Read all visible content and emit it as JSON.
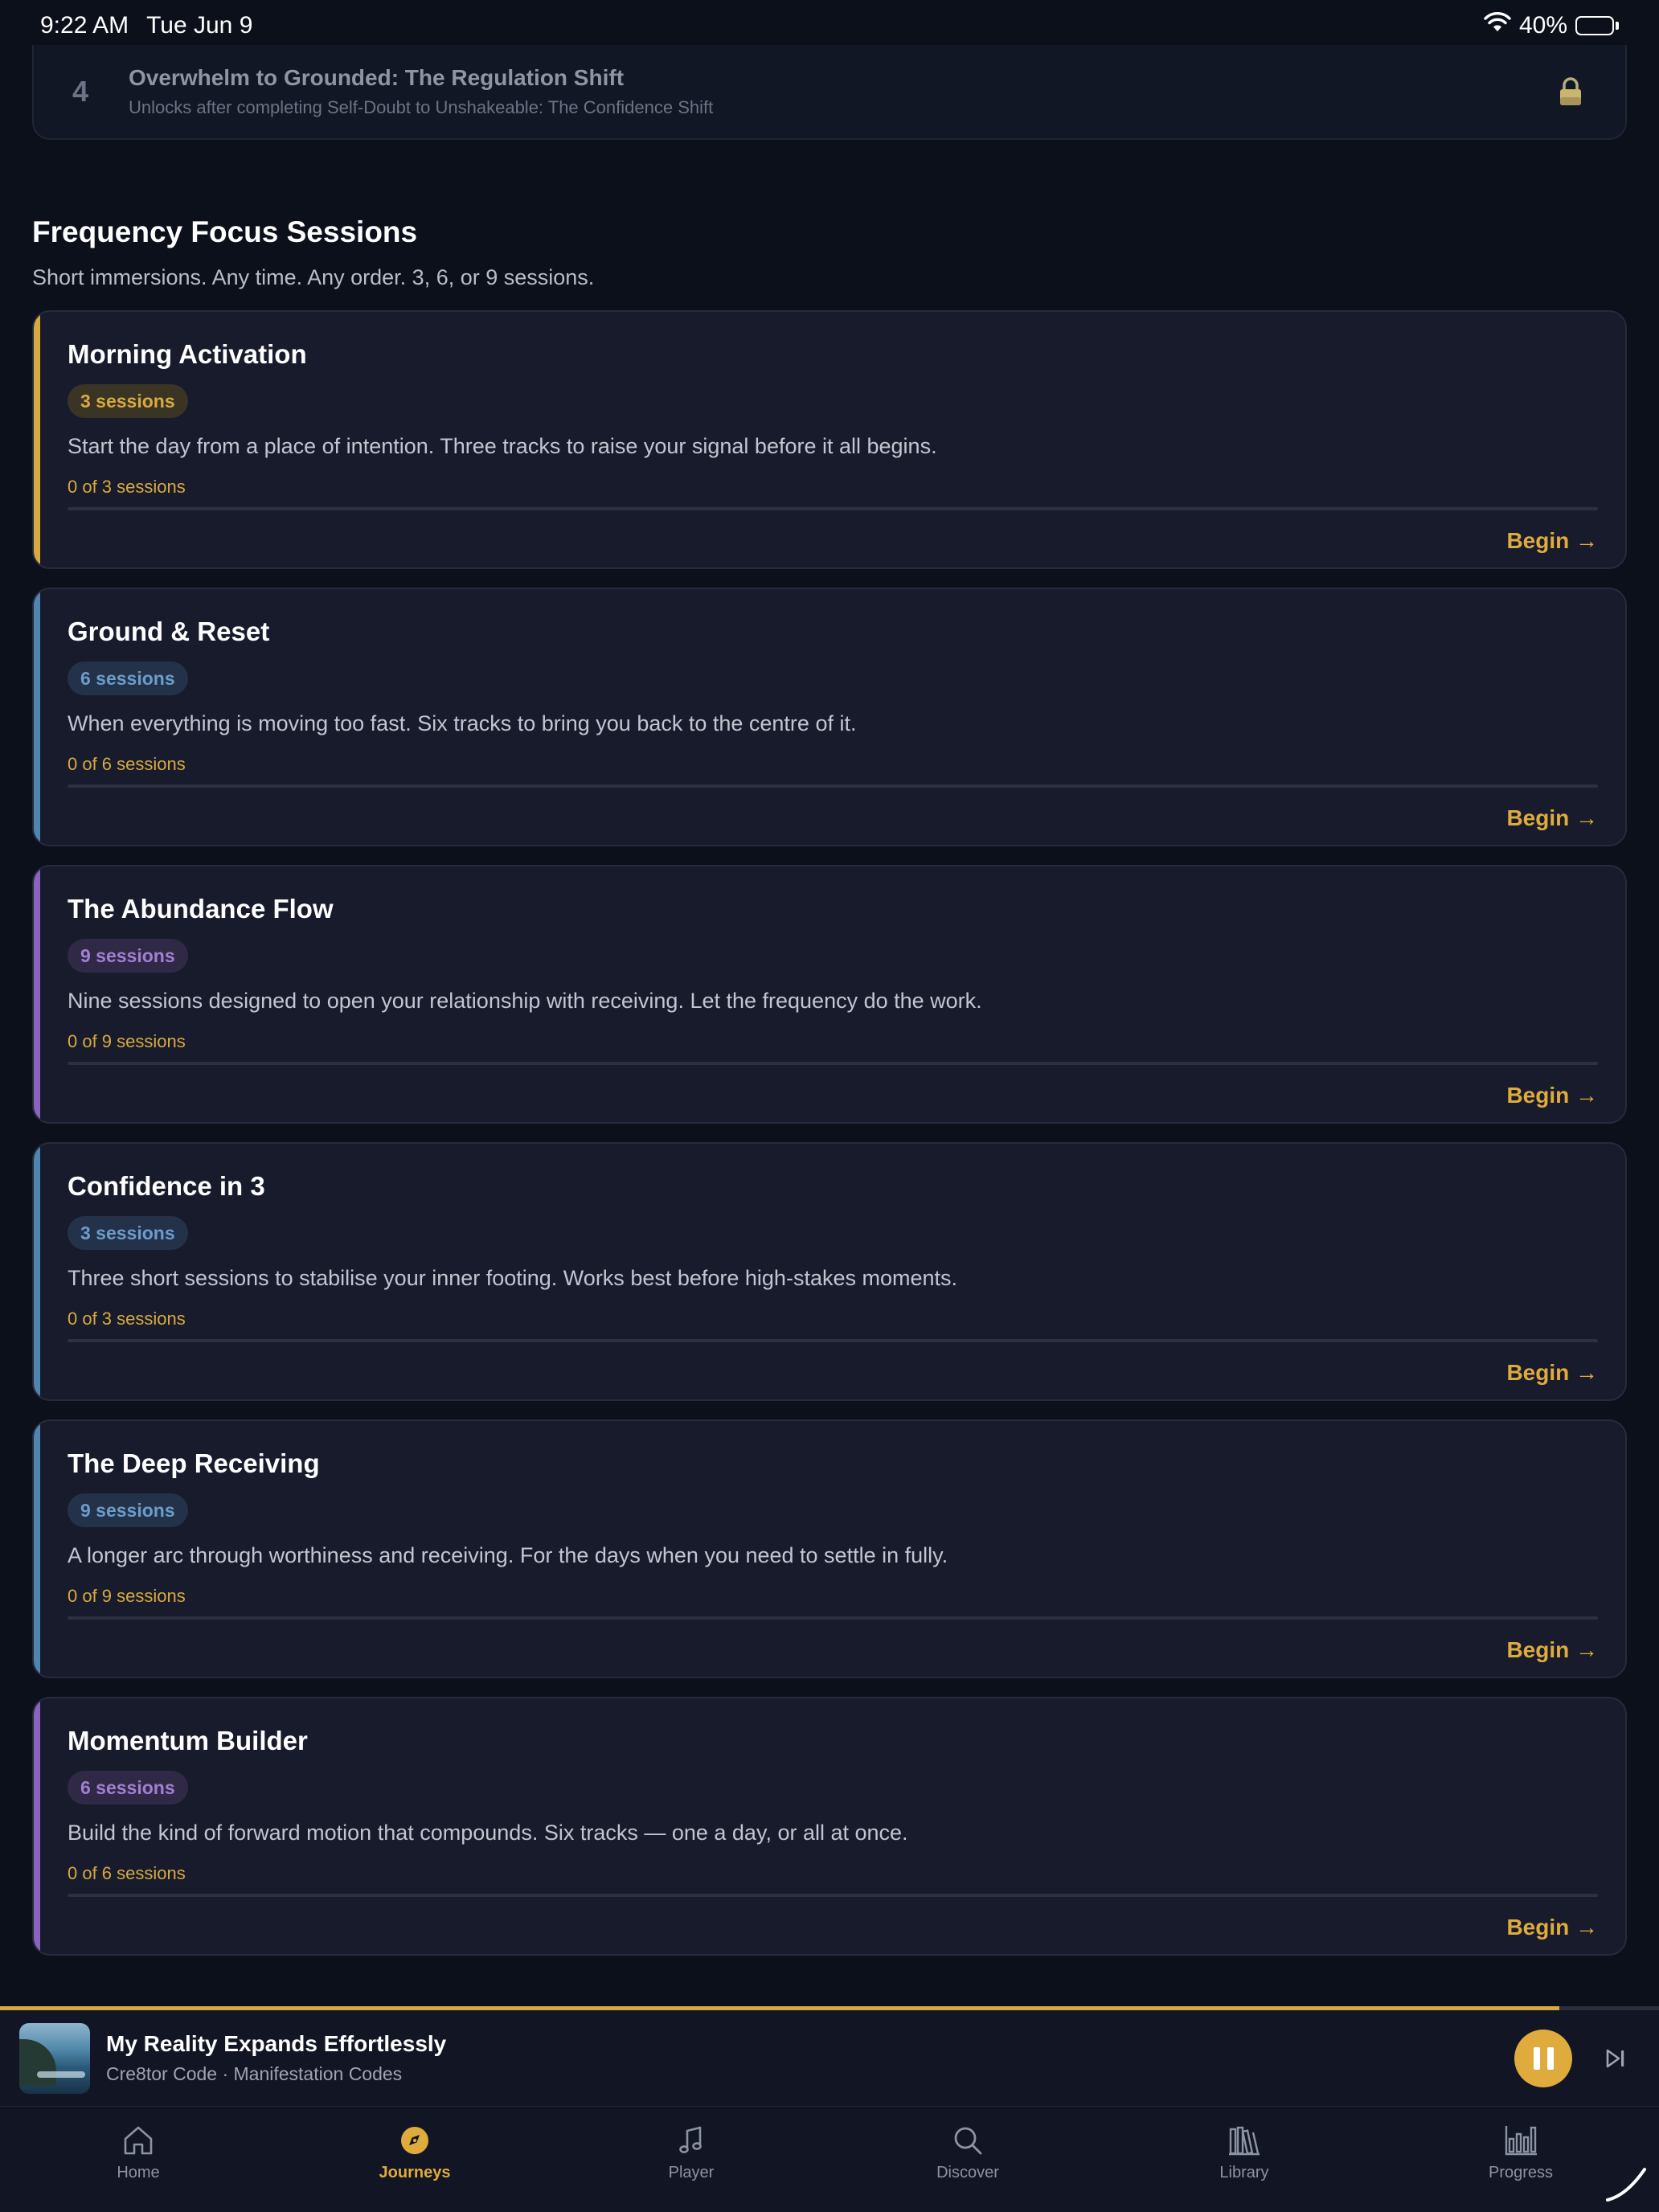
{
  "status_bar": {
    "time": "9:22 AM",
    "date": "Tue Jun 9",
    "battery": "40%"
  },
  "locked_journey": {
    "number": "4",
    "title": "Overwhelm to Grounded: The Regulation Shift",
    "subtitle": "Unlocks after completing Self-Doubt to Unshakeable: The Confidence Shift",
    "icon": "lock-icon"
  },
  "section": {
    "title": "Frequency Focus Sessions",
    "subtitle": "Short immersions. Any time. Any order. 3, 6, or 9 sessions."
  },
  "cards": [
    {
      "title": "Morning Activation",
      "badge": "3 sessions",
      "description": "Start the day from a place of intention. Three tracks to raise your signal before it all begins.",
      "progress": "0 of 3 sessions",
      "progress_fraction": 0,
      "begin": "Begin →",
      "accent": "#d9a93f",
      "badge_bg": "#3a3425",
      "badge_fg": "#d9a93f"
    },
    {
      "title": "Ground & Reset",
      "badge": "6 sessions",
      "description": "When everything is moving too fast. Six tracks to bring you back to the centre of it.",
      "progress": "0 of 6 sessions",
      "progress_fraction": 0,
      "begin": "Begin →",
      "accent": "#4f86b0",
      "badge_bg": "#243249",
      "badge_fg": "#6b9ccc"
    },
    {
      "title": "The Abundance Flow",
      "badge": "9 sessions",
      "description": "Nine sessions designed to open your relationship with receiving. Let the frequency do the work.",
      "progress": "0 of 9 sessions",
      "progress_fraction": 0,
      "begin": "Begin →",
      "accent": "#8a63c0",
      "badge_bg": "#302945",
      "badge_fg": "#a27fd4"
    },
    {
      "title": "Confidence in 3",
      "badge": "3 sessions",
      "description": "Three short sessions to stabilise your inner footing. Works best before high-stakes moments.",
      "progress": "0 of 3 sessions",
      "progress_fraction": 0,
      "begin": "Begin →",
      "accent": "#4f86b0",
      "badge_bg": "#243249",
      "badge_fg": "#6b9ccc"
    },
    {
      "title": "The Deep Receiving",
      "badge": "9 sessions",
      "description": "A longer arc through worthiness and receiving. For the days when you need to settle in fully.",
      "progress": "0 of 9 sessions",
      "progress_fraction": 0,
      "begin": "Begin →",
      "accent": "#4f86b0",
      "badge_bg": "#243249",
      "badge_fg": "#6b9ccc"
    },
    {
      "title": "Momentum Builder",
      "badge": "6 sessions",
      "description": "Build the kind of forward motion that compounds. Six tracks — one a day, or all at once.",
      "progress": "0 of 6 sessions",
      "progress_fraction": 0,
      "begin": "Begin →",
      "accent": "#8a63c0",
      "badge_bg": "#302945",
      "badge_fg": "#a27fd4"
    }
  ],
  "now_playing": {
    "title": "My Reality Expands Effortlessly",
    "artist": "Cre8tor Code · Manifestation Codes",
    "progress_fraction": 0.94
  },
  "tabs": [
    {
      "label": "Home",
      "icon": "home-icon",
      "active": false
    },
    {
      "label": "Journeys",
      "icon": "compass-icon",
      "active": true
    },
    {
      "label": "Player",
      "icon": "music-note-icon",
      "active": false
    },
    {
      "label": "Discover",
      "icon": "search-icon",
      "active": false
    },
    {
      "label": "Library",
      "icon": "library-icon",
      "active": false
    },
    {
      "label": "Progress",
      "icon": "bar-chart-icon",
      "active": false
    }
  ],
  "colors": {
    "accent": "#e0ab3d",
    "background": "#0c101b",
    "card": "#171b2c"
  }
}
